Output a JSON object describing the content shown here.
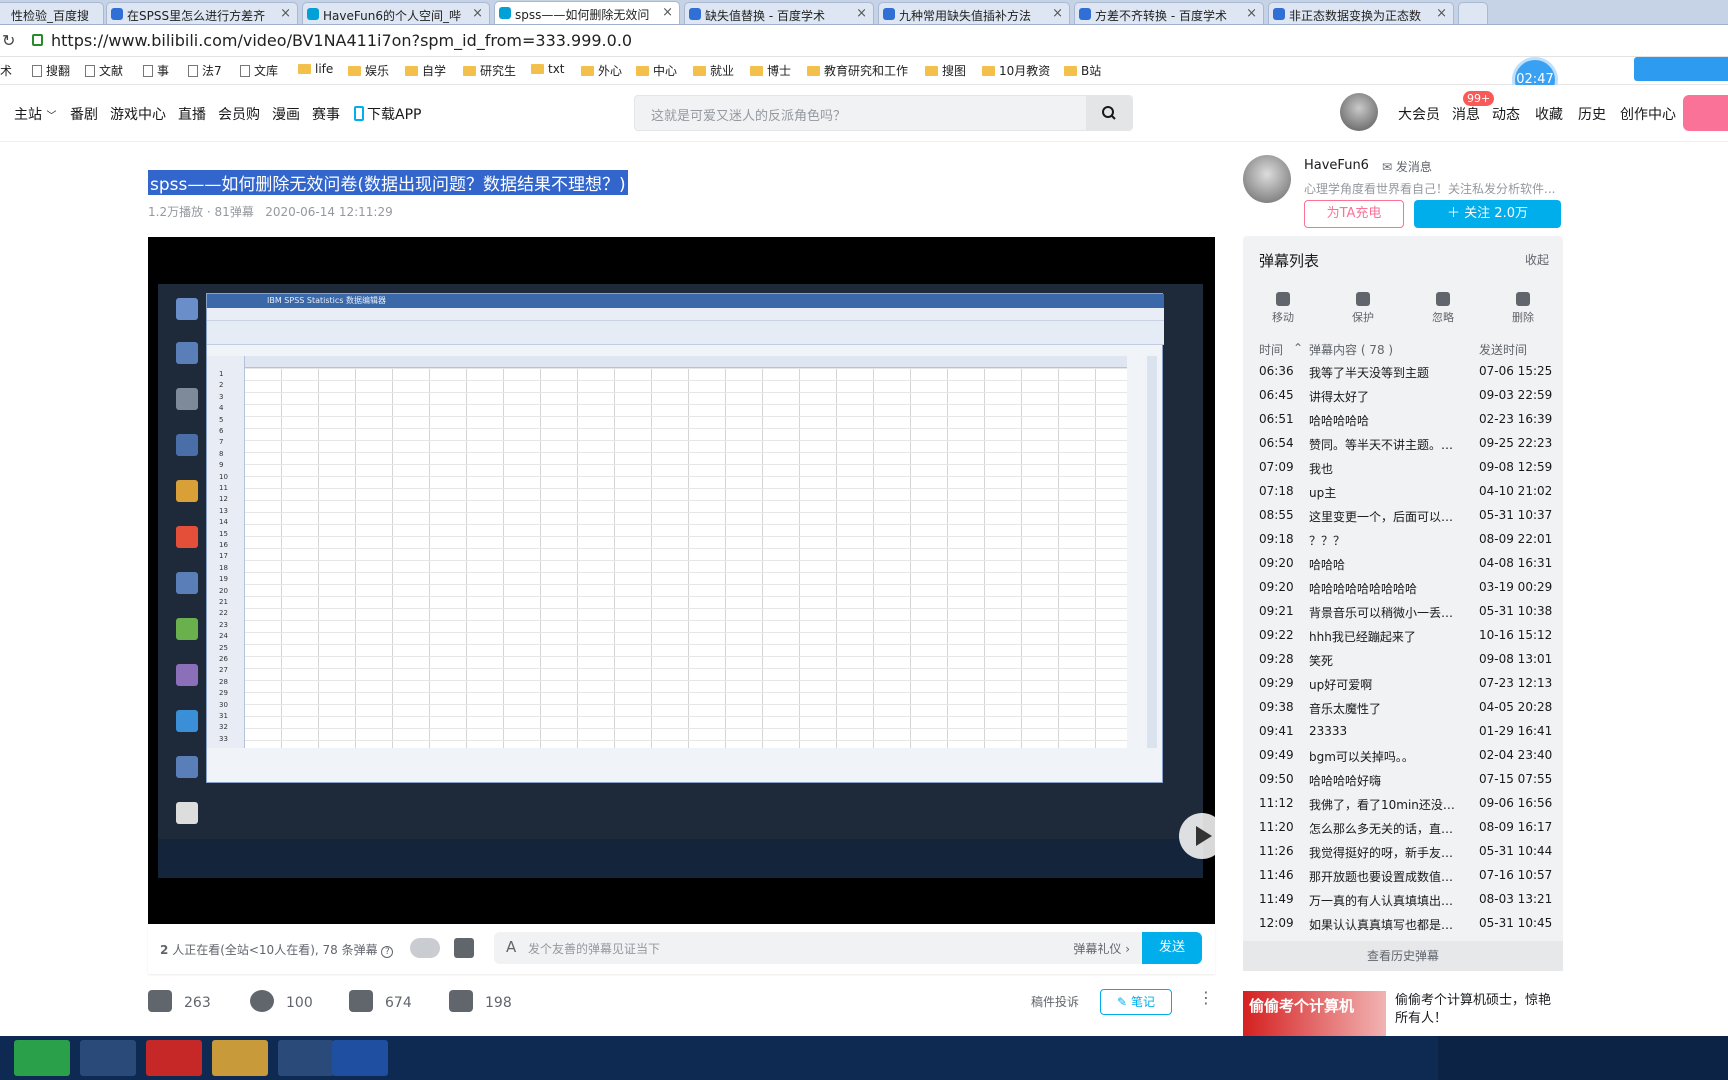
{
  "browser": {
    "tabs": [
      {
        "label": "性检验_百度搜",
        "active": false
      },
      {
        "label": "在SPSS里怎么进行方差齐",
        "active": false
      },
      {
        "label": "HaveFun6的个人空间_哔",
        "active": false
      },
      {
        "label": "spss——如何删除无效问",
        "active": true
      },
      {
        "label": "缺失值替换 - 百度学术",
        "active": false
      },
      {
        "label": "九种常用缺失值插补方法",
        "active": false
      },
      {
        "label": "方差不齐转换 - 百度学术",
        "active": false
      },
      {
        "label": "非正态数据变换为正态数",
        "active": false
      }
    ],
    "url": "https://www.bilibili.com/video/BV1NA411i7on?spm_id_from=333.999.0.0",
    "bookmarks": [
      "术",
      "搜翻",
      "文献",
      "事",
      "法7",
      "文库",
      "life",
      "娱乐",
      "自学",
      "研究生",
      "txt",
      "外心",
      "中心",
      "就业",
      "博士",
      "教育研究和工作",
      "搜图",
      "10月教资",
      "B站"
    ]
  },
  "header": {
    "nav": [
      "主站",
      "番剧",
      "游戏中心",
      "直播",
      "会员购",
      "漫画",
      "赛事",
      "下载APP"
    ],
    "search_placeholder": "这就是可爱又迷人的反派角色吗？",
    "right_nav": [
      "大会员",
      "消息",
      "动态",
      "收藏",
      "历史",
      "创作中心"
    ],
    "message_badge": "99+",
    "timer": "02:47"
  },
  "video": {
    "title": "spss——如何删除无效问卷(数据出现问题？数据结果不理想？)",
    "views": "1.2万播放",
    "danmaku_count": "81弹幕",
    "date": "2020-06-14 12:11:29",
    "spss_window_title": "IBM SPSS Statistics 数据编辑器",
    "row_numbers": [
      "1",
      "2",
      "3",
      "4",
      "5",
      "6",
      "7",
      "8",
      "9",
      "10",
      "11",
      "12",
      "13",
      "14",
      "15",
      "16",
      "17",
      "18",
      "19",
      "20",
      "21",
      "22",
      "23",
      "24",
      "25",
      "26",
      "27",
      "28",
      "29",
      "30",
      "31",
      "32",
      "33"
    ]
  },
  "sendbar": {
    "viewers_count": "2",
    "viewers_text": "人正在看(全站<10人在看), 78 条弹幕",
    "placeholder": "发个友善的弹幕见证当下",
    "etiquette": "弹幕礼仪",
    "send": "发送"
  },
  "actions": {
    "like": "263",
    "coin": "100",
    "fav": "674",
    "share": "198",
    "report": "稿件投诉",
    "note": "笔记"
  },
  "uploader": {
    "name": "HaveFun6",
    "message": "发消息",
    "desc": "心理学角度看世界看自己！关注私发分析软件...",
    "charge": "为TA充电",
    "follow": "关注 2.0万"
  },
  "danmaku_list": {
    "title": "弹幕列表",
    "collapse": "收起",
    "tools": [
      "移动",
      "保护",
      "忽略",
      "删除"
    ],
    "col_time": "时间",
    "col_content": "弹幕内容 ( 78 )",
    "col_sent": "发送时间",
    "rows": [
      {
        "t": "06:36",
        "c": "我等了半天没等到主题",
        "s": "07-06 15:25"
      },
      {
        "t": "06:45",
        "c": "讲得太好了",
        "s": "09-03 22:59"
      },
      {
        "t": "06:51",
        "c": "哈哈哈哈哈",
        "s": "02-23 16:39"
      },
      {
        "t": "06:54",
        "c": "赞同。等半天不讲主题。废...",
        "s": "09-25 22:23"
      },
      {
        "t": "07:09",
        "c": "我也",
        "s": "09-08 12:59"
      },
      {
        "t": "07:18",
        "c": "up主",
        "s": "04-10 21:02"
      },
      {
        "t": "08:55",
        "c": "这里变更一个，后面可以复...",
        "s": "05-31 10:37"
      },
      {
        "t": "09:18",
        "c": "？？？",
        "s": "08-09 22:01"
      },
      {
        "t": "09:20",
        "c": "哈哈哈",
        "s": "04-08 16:31"
      },
      {
        "t": "09:20",
        "c": "哈哈哈哈哈哈哈哈哈",
        "s": "03-19 00:29"
      },
      {
        "t": "09:21",
        "c": "背景音乐可以稍微小一丢丢...",
        "s": "05-31 10:38"
      },
      {
        "t": "09:22",
        "c": "hhh我已经蹦起来了",
        "s": "10-16 15:12"
      },
      {
        "t": "09:28",
        "c": "笑死",
        "s": "09-08 13:01"
      },
      {
        "t": "09:29",
        "c": "up好可爱啊",
        "s": "07-23 12:13"
      },
      {
        "t": "09:38",
        "c": "音乐太魔性了",
        "s": "04-05 20:28"
      },
      {
        "t": "09:41",
        "c": "23333",
        "s": "01-29 16:41"
      },
      {
        "t": "09:49",
        "c": "bgm可以关掉吗。。",
        "s": "02-04 23:40"
      },
      {
        "t": "09:50",
        "c": "哈哈哈哈好嗨",
        "s": "07-15 07:55"
      },
      {
        "t": "11:12",
        "c": "我佛了，看了10min还没开...",
        "s": "09-06 16:56"
      },
      {
        "t": "11:20",
        "c": "怎么那么多无关的话，直入...",
        "s": "08-09 16:17"
      },
      {
        "t": "11:26",
        "c": "我觉得挺好的呀，新手友好...",
        "s": "05-31 10:44"
      },
      {
        "t": "11:46",
        "c": "那开放题也要设置成数值吗？",
        "s": "07-16 10:57"
      },
      {
        "t": "11:49",
        "c": "万一真的有人认真填填出来...",
        "s": "08-03 13:21"
      },
      {
        "t": "12:09",
        "c": "如果认认真真填写也都是4...",
        "s": "05-31 10:45"
      }
    ],
    "history": "查看历史弹幕"
  },
  "ad": {
    "image_text": "偷偷考个计算机",
    "text": "偷偷考个计算机硕士，惊艳所有人！"
  }
}
